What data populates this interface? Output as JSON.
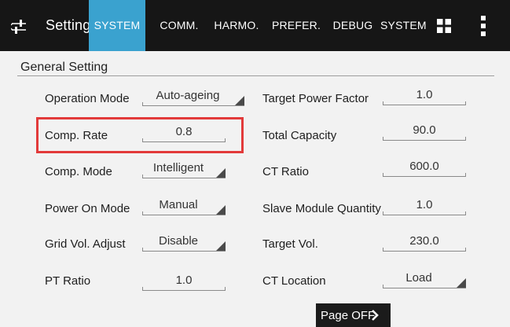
{
  "header": {
    "title": "Setting",
    "tabs": [
      {
        "label": "SYSTEM",
        "active": true
      },
      {
        "label": "COMM."
      },
      {
        "label": "HARMO."
      },
      {
        "label": "PREFER."
      },
      {
        "label": "DEBUG"
      },
      {
        "label": "SYSTEM"
      }
    ],
    "icons": [
      "back-arrow-icon",
      "settings-sliders-icon",
      "grid-icon",
      "more-vert-icon"
    ]
  },
  "section": {
    "title": "General Setting"
  },
  "left_fields": [
    {
      "label": "Operation Mode",
      "value": "Auto-ageing",
      "type": "dropdown"
    },
    {
      "label": "Comp. Rate",
      "value": "0.8",
      "type": "input",
      "highlighted": true
    },
    {
      "label": "Comp. Mode",
      "value": "Intelligent",
      "type": "dropdown"
    },
    {
      "label": "Power On Mode",
      "value": "Manual",
      "type": "dropdown"
    },
    {
      "label": "Grid Vol. Adjust",
      "value": "Disable",
      "type": "dropdown"
    },
    {
      "label": "PT Ratio",
      "value": "1.0",
      "type": "input"
    }
  ],
  "right_fields": [
    {
      "label": "Target Power Factor",
      "value": "1.0",
      "type": "input"
    },
    {
      "label": "Total Capacity",
      "value": "90.0",
      "type": "input"
    },
    {
      "label": "CT Ratio",
      "value": "600.0",
      "type": "input"
    },
    {
      "label": "Slave Module Quantity",
      "value": "1.0",
      "type": "input"
    },
    {
      "label": "Target Vol.",
      "value": "230.0",
      "type": "input"
    },
    {
      "label": "CT Location",
      "value": "Load",
      "type": "dropdown"
    }
  ],
  "page_button": {
    "label": "Page OFF"
  },
  "colors": {
    "topbar": "#161616",
    "active_tab": "#3aa2cf",
    "highlight": "#e23a3a",
    "background": "#f2f2f2"
  }
}
